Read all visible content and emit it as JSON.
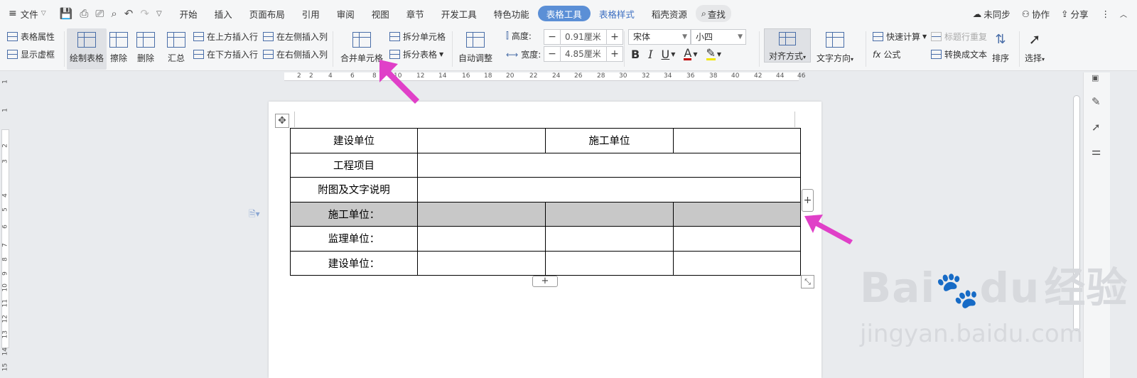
{
  "menubar": {
    "file_label": "文件",
    "tabs": [
      "开始",
      "插入",
      "页面布局",
      "引用",
      "审阅",
      "视图",
      "章节",
      "开发工具",
      "特色功能",
      "表格工具",
      "表格样式",
      "稻壳资源"
    ],
    "search_label": "查找",
    "right_items": [
      "未同步",
      "协作",
      "分享"
    ]
  },
  "ribbon": {
    "table_props": "表格属性",
    "show_grid": "显示虚框",
    "draw_table": "绘制表格",
    "erase": "擦除",
    "delete": "删除",
    "summary": "汇总",
    "insert_above": "在上方插入行",
    "insert_below": "在下方插入行",
    "insert_left": "在左侧插入列",
    "insert_right": "在右侧插入列",
    "merge_cells": "合并单元格",
    "split_cells": "拆分单元格",
    "split_table": "拆分表格",
    "auto_fit": "自动调整",
    "height_label": "高度:",
    "height_value": "0.91厘米",
    "width_label": "宽度:",
    "width_value": "4.85厘米",
    "font_name": "宋体",
    "font_size": "小四",
    "align": "对齐方式",
    "text_dir": "文字方向",
    "quick_calc": "快速计算",
    "repeat_title": "标题行重复",
    "formula": "公式",
    "to_text": "转换成文本",
    "sort": "排序",
    "select": "选择"
  },
  "ruler_h": [
    "2",
    "2",
    "4",
    "6",
    "8",
    "10",
    "12",
    "14",
    "16",
    "18",
    "20",
    "22",
    "24",
    "26",
    "28",
    "30",
    "32",
    "34",
    "36",
    "38",
    "40",
    "42",
    "44",
    "46"
  ],
  "ruler_v": [
    "1",
    "1",
    "2",
    "3",
    "4",
    "5",
    "6",
    "7",
    "8",
    "9",
    "10",
    "11",
    "12",
    "13",
    "14",
    "15"
  ],
  "table": {
    "r1": [
      "建设单位",
      "",
      "施工单位",
      ""
    ],
    "r2": [
      "工程项目",
      ""
    ],
    "r3": [
      "附图及文字说明",
      ""
    ],
    "r4": [
      "施工单位：",
      "",
      "",
      ""
    ],
    "r5": [
      "监理单位：",
      "",
      "",
      ""
    ],
    "r6": [
      "建设单位：",
      "",
      "",
      ""
    ]
  },
  "watermark": {
    "line1": "Bai",
    "line1b": "du",
    "line1c": "经验",
    "line2": "jingyan.baidu.com"
  },
  "colors": {
    "accent": "#5b8fd6",
    "arrow": "#e040c8",
    "selected_row": "#c8c8c8"
  }
}
